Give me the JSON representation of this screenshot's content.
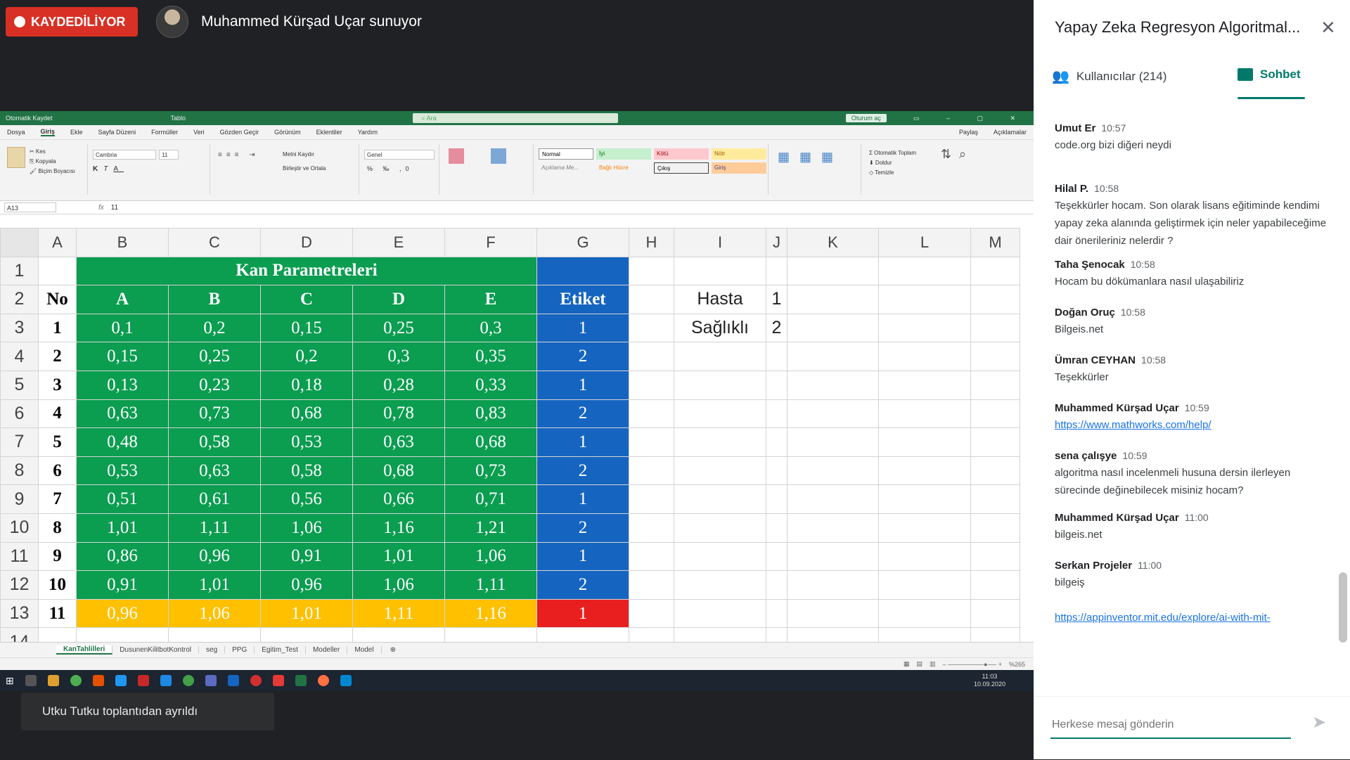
{
  "meeting": {
    "recording_label": "KAYDEDİLİYOR",
    "presenter_text": "Muhammed Kürşad Uçar sunuyor",
    "toast": "Utku Tutku toplantıdan ayrıldı"
  },
  "excel": {
    "autosave_label": "Otomatik Kaydet",
    "file_name": "Tablo",
    "search_placeholder": "Ara",
    "signin_button": "Oturum aç",
    "menu": [
      "Dosya",
      "Giriş",
      "Ekle",
      "Sayfa Düzeni",
      "Formüller",
      "Veri",
      "Gözden Geçir",
      "Görünüm",
      "Eklentiler",
      "Yardım"
    ],
    "share_label": "Paylaş",
    "comments_label": "Açıklamalar",
    "font_name": "Cambria",
    "font_size": "11",
    "number_format": "Genel",
    "styles": {
      "normal": "Normal",
      "good": "İyi",
      "bad": "Kötü",
      "neutral": "Nötr",
      "explanation": "Açıklama Me...",
      "linked": "Bağlı Hücre",
      "output": "Çıkış",
      "input": "Giriş"
    },
    "name_box": "A13",
    "formula_value": "11",
    "columns": [
      "A",
      "B",
      "C",
      "D",
      "E",
      "F",
      "G",
      "H",
      "I",
      "J",
      "K",
      "L",
      "M"
    ],
    "title": "Kan Parametreleri",
    "headers": [
      "No",
      "A",
      "B",
      "C",
      "D",
      "E",
      "Etiket"
    ],
    "rows": [
      [
        "1",
        "0,1",
        "0,2",
        "0,15",
        "0,25",
        "0,3",
        "1"
      ],
      [
        "2",
        "0,15",
        "0,25",
        "0,2",
        "0,3",
        "0,35",
        "2"
      ],
      [
        "3",
        "0,13",
        "0,23",
        "0,18",
        "0,28",
        "0,33",
        "1"
      ],
      [
        "4",
        "0,63",
        "0,73",
        "0,68",
        "0,78",
        "0,83",
        "2"
      ],
      [
        "5",
        "0,48",
        "0,58",
        "0,53",
        "0,63",
        "0,68",
        "1"
      ],
      [
        "6",
        "0,53",
        "0,63",
        "0,58",
        "0,68",
        "0,73",
        "2"
      ],
      [
        "7",
        "0,51",
        "0,61",
        "0,56",
        "0,66",
        "0,71",
        "1"
      ],
      [
        "8",
        "1,01",
        "1,11",
        "1,06",
        "1,16",
        "1,21",
        "2"
      ],
      [
        "9",
        "0,86",
        "0,96",
        "0,91",
        "1,01",
        "1,06",
        "1"
      ],
      [
        "10",
        "0,91",
        "1,01",
        "0,96",
        "1,06",
        "1,11",
        "2"
      ],
      [
        "11",
        "0,96",
        "1,06",
        "1,01",
        "1,11",
        "1,16",
        "1"
      ]
    ],
    "legend": [
      {
        "label": "Hasta",
        "value": "1"
      },
      {
        "label": "Sağlıklı",
        "value": "2"
      }
    ],
    "sheet_tabs": [
      "KanTahlilleri",
      "DusunenKilitbotKontrol",
      "seg",
      "PPG",
      "Egitim_Test",
      "Modeller",
      "Model"
    ],
    "zoom": "%265",
    "clock_time": "11:03",
    "clock_date": "10.09.2020",
    "colors": {
      "green": "#0b9d50",
      "blue": "#1565c0",
      "yellow": "#ffc000",
      "red": "#e91e1e",
      "excel": "#217346"
    }
  },
  "panel": {
    "title": "Yapay Zeka Regresyon Algoritmal...",
    "users_tab": "Kullanıcılar (214)",
    "chat_tab": "Sohbet",
    "input_placeholder": "Herkese mesaj gönderin",
    "messages": [
      {
        "sender": "Umut Er",
        "time": "10:57",
        "text": "code.org bizi diğeri neydi"
      },
      {
        "sender": "Hilal P.",
        "time": "10:58",
        "text": "Teşekkürler hocam. Son olarak lisans eğitiminde kendimi yapay zeka alanında geliştirmek için neler yapabileceğime dair önerileriniz nelerdir ?"
      },
      {
        "sender": "Taha Şenocak",
        "time": "10:58",
        "text": "Hocam bu dökümanlara nasıl ulaşabiliriz"
      },
      {
        "sender": "Doğan Oruç",
        "time": "10:58",
        "text": "Bilgeis.net"
      },
      {
        "sender": "Ümran CEYHAN",
        "time": "10:58",
        "text": "Teşekkürler"
      },
      {
        "sender": "Muhammed Kürşad Uçar",
        "time": "10:59",
        "text": "https://www.mathworks.com/help/"
      },
      {
        "sender": "sena çalışye",
        "time": "10:59",
        "text": "algoritma nasıl incelenmeli husuna dersin ilerleyen sürecinde değinebilecek misiniz hocam?"
      },
      {
        "sender": "Muhammed Kürşad Uçar",
        "time": "11:00",
        "text": "bilgeis.net"
      },
      {
        "sender": "Serkan Projeler",
        "time": "11:00",
        "text": "bilgeiş"
      },
      {
        "sender": "",
        "time": "",
        "text": "https://appinventor.mit.edu/explore/ai-with-mit-"
      }
    ]
  }
}
